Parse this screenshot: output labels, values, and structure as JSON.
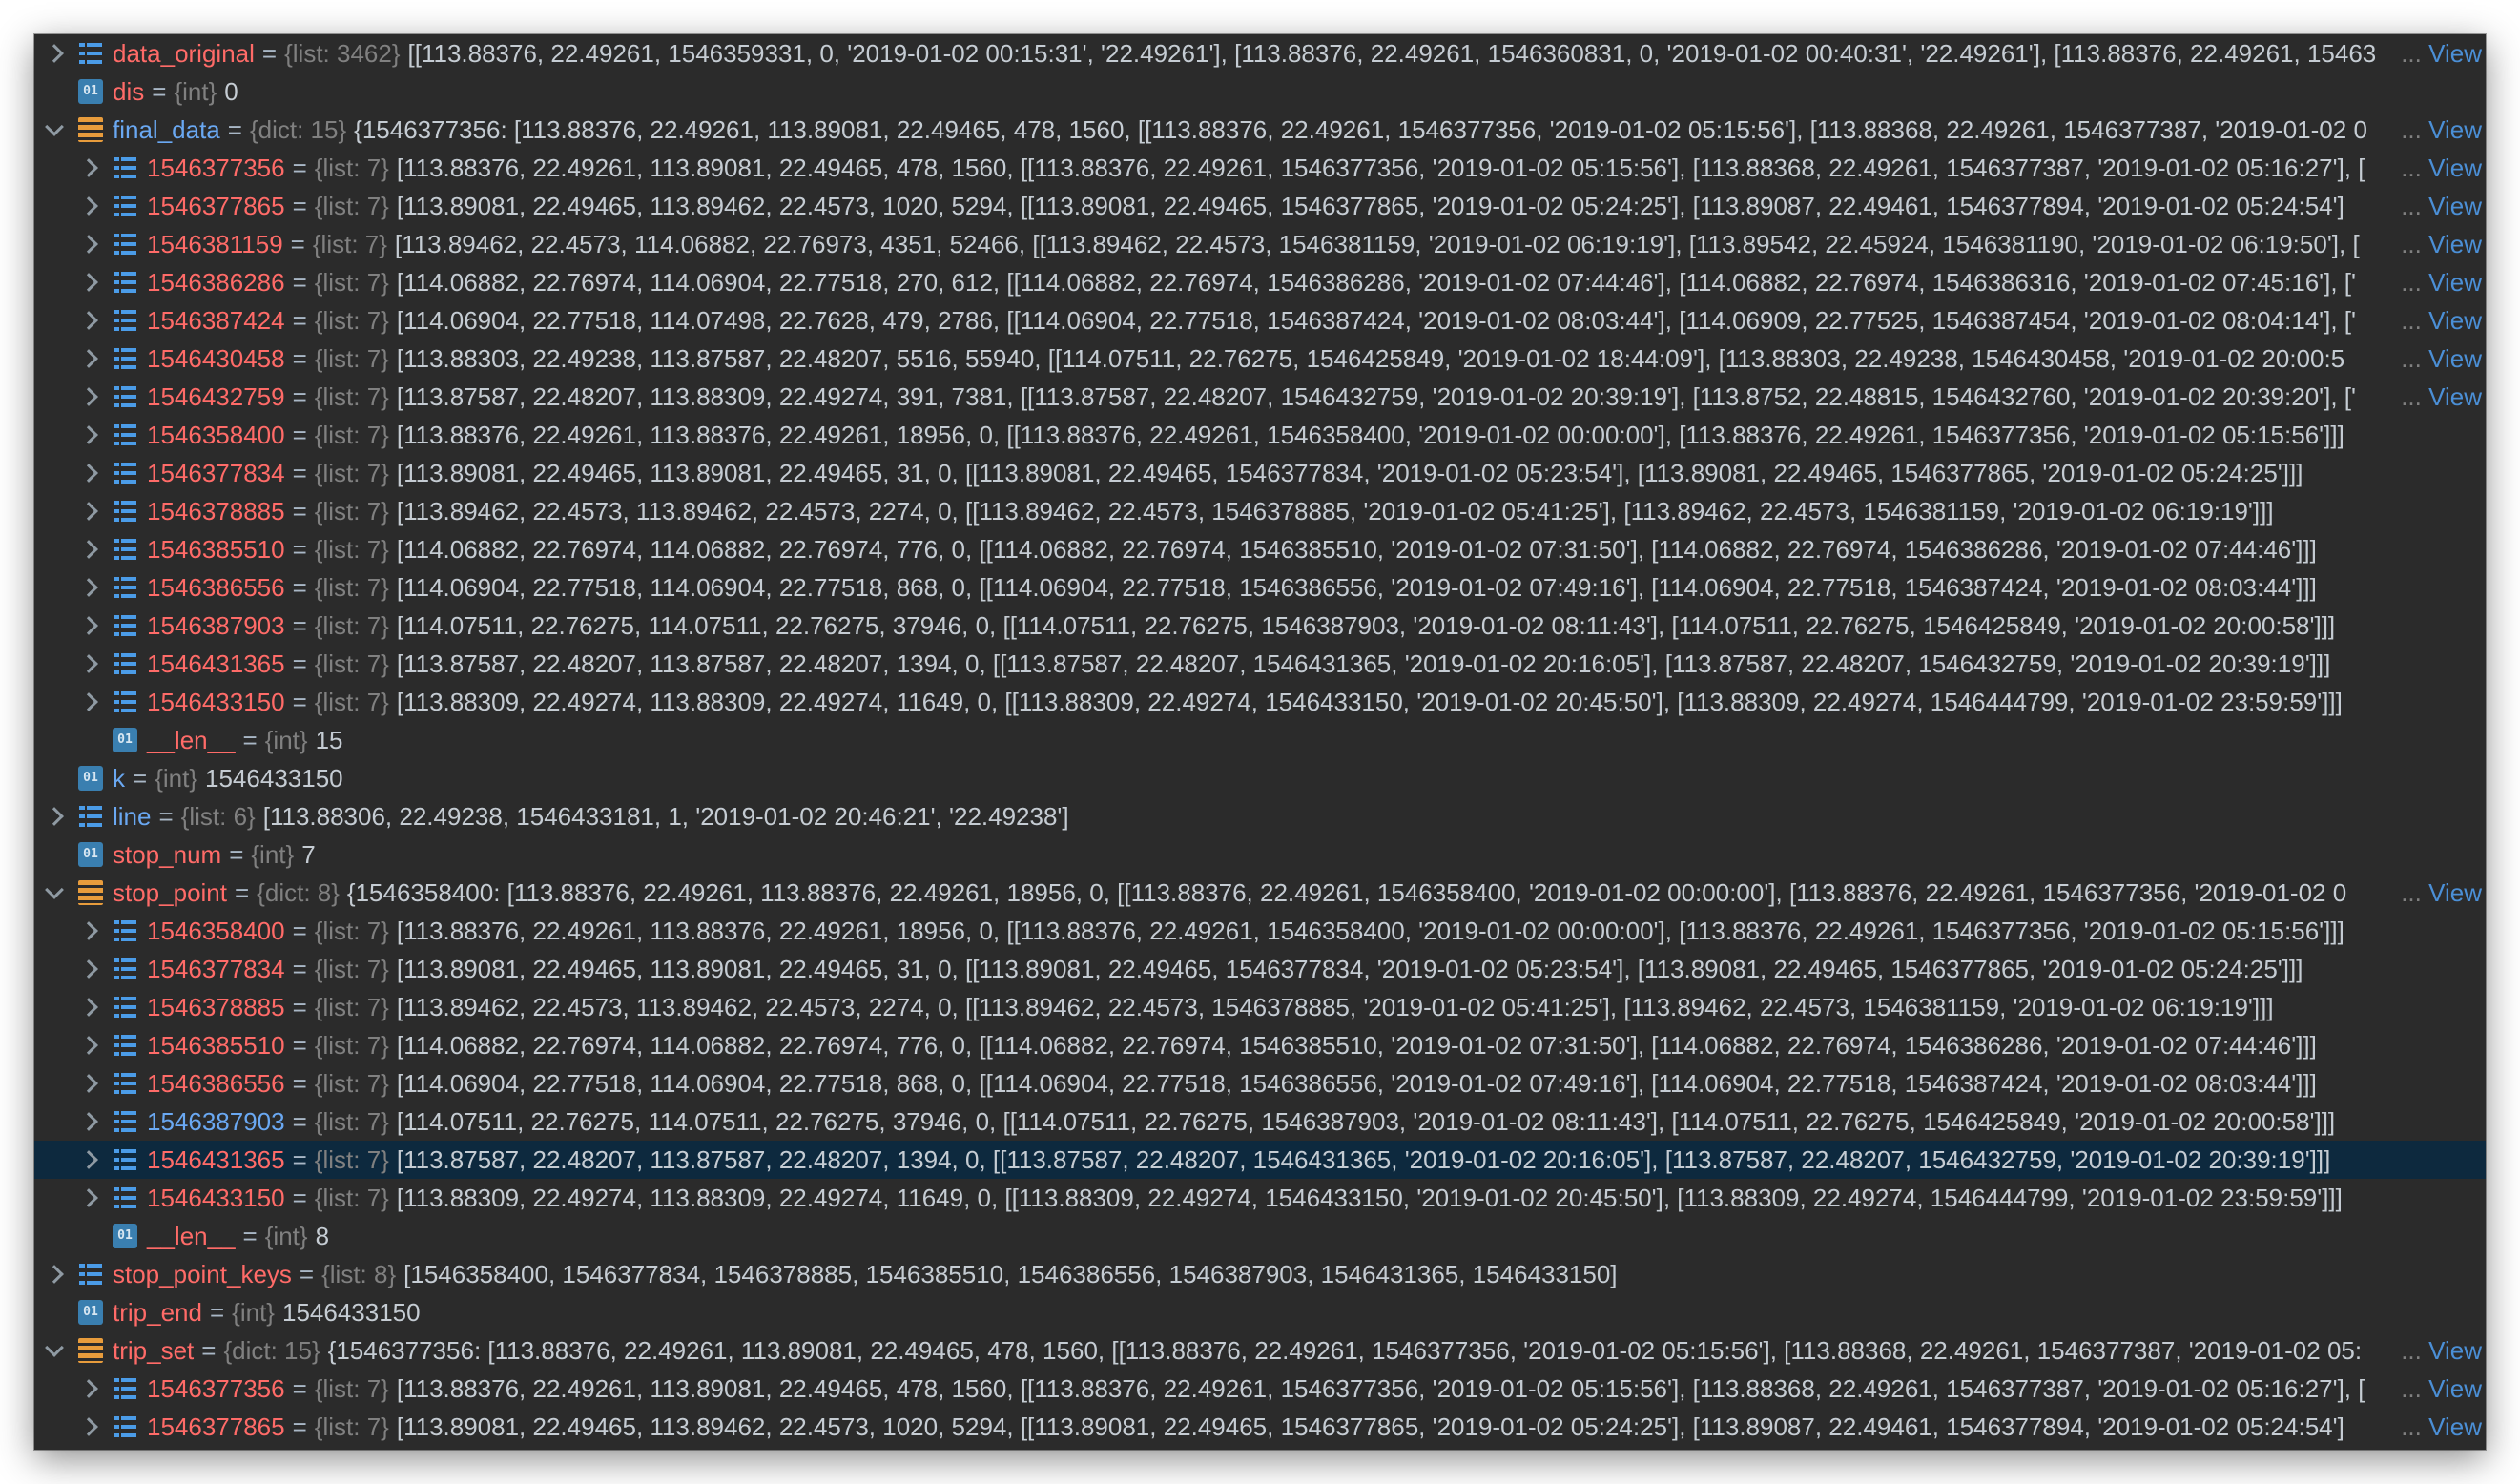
{
  "rows": [
    {
      "d": 0,
      "a": "collapsed",
      "i": "list",
      "k": "data_original",
      "kc": "red",
      "t": "{list: 3462}",
      "v": "[[113.88376, 22.49261, 1546359331, 0, '2019-01-02 00:15:31', '22.49261'], [113.88376, 22.49261, 1546360831, 0, '2019-01-02 00:40:31', '22.49261'], [113.88376, 22.49261, 15463",
      "view": "View"
    },
    {
      "d": 0,
      "a": "none",
      "i": "int",
      "k": "dis",
      "kc": "red",
      "t": "{int}",
      "v": "0"
    },
    {
      "d": 0,
      "a": "expanded",
      "i": "dict",
      "k": "final_data",
      "kc": "blue",
      "t": "{dict: 15}",
      "v": "{1546377356: [113.88376, 22.49261, 113.89081, 22.49465, 478, 1560, [[113.88376, 22.49261, 1546377356, '2019-01-02 05:15:56'], [113.88368, 22.49261, 1546377387, '2019-01-02 0",
      "view": "View"
    },
    {
      "d": 1,
      "a": "collapsed",
      "i": "list",
      "k": "1546377356",
      "kc": "red",
      "t": "{list: 7}",
      "v": "[113.88376, 22.49261, 113.89081, 22.49465, 478, 1560, [[113.88376, 22.49261, 1546377356, '2019-01-02 05:15:56'], [113.88368, 22.49261, 1546377387, '2019-01-02 05:16:27'], [",
      "view": "View"
    },
    {
      "d": 1,
      "a": "collapsed",
      "i": "list",
      "k": "1546377865",
      "kc": "red",
      "t": "{list: 7}",
      "v": "[113.89081, 22.49465, 113.89462, 22.4573, 1020, 5294, [[113.89081, 22.49465, 1546377865, '2019-01-02 05:24:25'], [113.89087, 22.49461, 1546377894, '2019-01-02 05:24:54']",
      "view": "View"
    },
    {
      "d": 1,
      "a": "collapsed",
      "i": "list",
      "k": "1546381159",
      "kc": "red",
      "t": "{list: 7}",
      "v": "[113.89462, 22.4573, 114.06882, 22.76973, 4351, 52466, [[113.89462, 22.4573, 1546381159, '2019-01-02 06:19:19'], [113.89542, 22.45924, 1546381190, '2019-01-02 06:19:50'], [",
      "view": "View"
    },
    {
      "d": 1,
      "a": "collapsed",
      "i": "list",
      "k": "1546386286",
      "kc": "red",
      "t": "{list: 7}",
      "v": "[114.06882, 22.76974, 114.06904, 22.77518, 270, 612, [[114.06882, 22.76974, 1546386286, '2019-01-02 07:44:46'], [114.06882, 22.76974, 1546386316, '2019-01-02 07:45:16'], ['",
      "view": "View"
    },
    {
      "d": 1,
      "a": "collapsed",
      "i": "list",
      "k": "1546387424",
      "kc": "red",
      "t": "{list: 7}",
      "v": "[114.06904, 22.77518, 114.07498, 22.7628, 479, 2786, [[114.06904, 22.77518, 1546387424, '2019-01-02 08:03:44'], [114.06909, 22.77525, 1546387454, '2019-01-02 08:04:14'], ['",
      "view": "View"
    },
    {
      "d": 1,
      "a": "collapsed",
      "i": "list",
      "k": "1546430458",
      "kc": "red",
      "t": "{list: 7}",
      "v": "[113.88303, 22.49238, 113.87587, 22.48207, 5516, 55940, [[114.07511, 22.76275, 1546425849, '2019-01-02 18:44:09'], [113.88303, 22.49238, 1546430458, '2019-01-02 20:00:5",
      "view": "View"
    },
    {
      "d": 1,
      "a": "collapsed",
      "i": "list",
      "k": "1546432759",
      "kc": "red",
      "t": "{list: 7}",
      "v": "[113.87587, 22.48207, 113.88309, 22.49274, 391, 7381, [[113.87587, 22.48207, 1546432759, '2019-01-02 20:39:19'], [113.8752, 22.48815, 1546432760, '2019-01-02 20:39:20'], ['",
      "view": "View"
    },
    {
      "d": 1,
      "a": "collapsed",
      "i": "list",
      "k": "1546358400",
      "kc": "red",
      "t": "{list: 7}",
      "v": "[113.88376, 22.49261, 113.88376, 22.49261, 18956, 0, [[113.88376, 22.49261, 1546358400, '2019-01-02 00:00:00'], [113.88376, 22.49261, 1546377356, '2019-01-02 05:15:56']]]"
    },
    {
      "d": 1,
      "a": "collapsed",
      "i": "list",
      "k": "1546377834",
      "kc": "red",
      "t": "{list: 7}",
      "v": "[113.89081, 22.49465, 113.89081, 22.49465, 31, 0, [[113.89081, 22.49465, 1546377834, '2019-01-02 05:23:54'], [113.89081, 22.49465, 1546377865, '2019-01-02 05:24:25']]]"
    },
    {
      "d": 1,
      "a": "collapsed",
      "i": "list",
      "k": "1546378885",
      "kc": "red",
      "t": "{list: 7}",
      "v": "[113.89462, 22.4573, 113.89462, 22.4573, 2274, 0, [[113.89462, 22.4573, 1546378885, '2019-01-02 05:41:25'], [113.89462, 22.4573, 1546381159, '2019-01-02 06:19:19']]]"
    },
    {
      "d": 1,
      "a": "collapsed",
      "i": "list",
      "k": "1546385510",
      "kc": "red",
      "t": "{list: 7}",
      "v": "[114.06882, 22.76974, 114.06882, 22.76974, 776, 0, [[114.06882, 22.76974, 1546385510, '2019-01-02 07:31:50'], [114.06882, 22.76974, 1546386286, '2019-01-02 07:44:46']]]"
    },
    {
      "d": 1,
      "a": "collapsed",
      "i": "list",
      "k": "1546386556",
      "kc": "red",
      "t": "{list: 7}",
      "v": "[114.06904, 22.77518, 114.06904, 22.77518, 868, 0, [[114.06904, 22.77518, 1546386556, '2019-01-02 07:49:16'], [114.06904, 22.77518, 1546387424, '2019-01-02 08:03:44']]]"
    },
    {
      "d": 1,
      "a": "collapsed",
      "i": "list",
      "k": "1546387903",
      "kc": "red",
      "t": "{list: 7}",
      "v": "[114.07511, 22.76275, 114.07511, 22.76275, 37946, 0, [[114.07511, 22.76275, 1546387903, '2019-01-02 08:11:43'], [114.07511, 22.76275, 1546425849, '2019-01-02 20:00:58']]]"
    },
    {
      "d": 1,
      "a": "collapsed",
      "i": "list",
      "k": "1546431365",
      "kc": "red",
      "t": "{list: 7}",
      "v": "[113.87587, 22.48207, 113.87587, 22.48207, 1394, 0, [[113.87587, 22.48207, 1546431365, '2019-01-02 20:16:05'], [113.87587, 22.48207, 1546432759, '2019-01-02 20:39:19']]]"
    },
    {
      "d": 1,
      "a": "collapsed",
      "i": "list",
      "k": "1546433150",
      "kc": "red",
      "t": "{list: 7}",
      "v": "[113.88309, 22.49274, 113.88309, 22.49274, 11649, 0, [[113.88309, 22.49274, 1546433150, '2019-01-02 20:45:50'], [113.88309, 22.49274, 1546444799, '2019-01-02 23:59:59']]]"
    },
    {
      "d": 1,
      "a": "none",
      "i": "int",
      "k": "__len__",
      "kc": "red",
      "t": "{int}",
      "v": "15"
    },
    {
      "d": 0,
      "a": "none",
      "i": "int",
      "k": "k",
      "kc": "blue",
      "t": "{int}",
      "v": "1546433150"
    },
    {
      "d": 0,
      "a": "collapsed",
      "i": "list",
      "k": "line",
      "kc": "blue",
      "t": "{list: 6}",
      "v": "[113.88306, 22.49238, 1546433181, 1, '2019-01-02 20:46:21', '22.49238']"
    },
    {
      "d": 0,
      "a": "none",
      "i": "int",
      "k": "stop_num",
      "kc": "red",
      "t": "{int}",
      "v": "7"
    },
    {
      "d": 0,
      "a": "expanded",
      "i": "dict",
      "k": "stop_point",
      "kc": "red",
      "t": "{dict: 8}",
      "v": "{1546358400: [113.88376, 22.49261, 113.88376, 22.49261, 18956, 0, [[113.88376, 22.49261, 1546358400, '2019-01-02 00:00:00'], [113.88376, 22.49261, 1546377356, '2019-01-02 0",
      "view": "View"
    },
    {
      "d": 1,
      "a": "collapsed",
      "i": "list",
      "k": "1546358400",
      "kc": "red",
      "t": "{list: 7}",
      "v": "[113.88376, 22.49261, 113.88376, 22.49261, 18956, 0, [[113.88376, 22.49261, 1546358400, '2019-01-02 00:00:00'], [113.88376, 22.49261, 1546377356, '2019-01-02 05:15:56']]]"
    },
    {
      "d": 1,
      "a": "collapsed",
      "i": "list",
      "k": "1546377834",
      "kc": "red",
      "t": "{list: 7}",
      "v": "[113.89081, 22.49465, 113.89081, 22.49465, 31, 0, [[113.89081, 22.49465, 1546377834, '2019-01-02 05:23:54'], [113.89081, 22.49465, 1546377865, '2019-01-02 05:24:25']]]"
    },
    {
      "d": 1,
      "a": "collapsed",
      "i": "list",
      "k": "1546378885",
      "kc": "red",
      "t": "{list: 7}",
      "v": "[113.89462, 22.4573, 113.89462, 22.4573, 2274, 0, [[113.89462, 22.4573, 1546378885, '2019-01-02 05:41:25'], [113.89462, 22.4573, 1546381159, '2019-01-02 06:19:19']]]"
    },
    {
      "d": 1,
      "a": "collapsed",
      "i": "list",
      "k": "1546385510",
      "kc": "red",
      "t": "{list: 7}",
      "v": "[114.06882, 22.76974, 114.06882, 22.76974, 776, 0, [[114.06882, 22.76974, 1546385510, '2019-01-02 07:31:50'], [114.06882, 22.76974, 1546386286, '2019-01-02 07:44:46']]]"
    },
    {
      "d": 1,
      "a": "collapsed",
      "i": "list",
      "k": "1546386556",
      "kc": "red",
      "t": "{list: 7}",
      "v": "[114.06904, 22.77518, 114.06904, 22.77518, 868, 0, [[114.06904, 22.77518, 1546386556, '2019-01-02 07:49:16'], [114.06904, 22.77518, 1546387424, '2019-01-02 08:03:44']]]"
    },
    {
      "d": 1,
      "a": "collapsed",
      "i": "list",
      "k": "1546387903",
      "kc": "blue",
      "t": "{list: 7}",
      "v": "[114.07511, 22.76275, 114.07511, 22.76275, 37946, 0, [[114.07511, 22.76275, 1546387903, '2019-01-02 08:11:43'], [114.07511, 22.76275, 1546425849, '2019-01-02 20:00:58']]]"
    },
    {
      "d": 1,
      "a": "collapsed",
      "i": "list",
      "k": "1546431365",
      "kc": "red",
      "t": "{list: 7}",
      "v": "[113.87587, 22.48207, 113.87587, 22.48207, 1394, 0, [[113.87587, 22.48207, 1546431365, '2019-01-02 20:16:05'], [113.87587, 22.48207, 1546432759, '2019-01-02 20:39:19']]]",
      "selected": true
    },
    {
      "d": 1,
      "a": "collapsed",
      "i": "list",
      "k": "1546433150",
      "kc": "red",
      "t": "{list: 7}",
      "v": "[113.88309, 22.49274, 113.88309, 22.49274, 11649, 0, [[113.88309, 22.49274, 1546433150, '2019-01-02 20:45:50'], [113.88309, 22.49274, 1546444799, '2019-01-02 23:59:59']]]"
    },
    {
      "d": 1,
      "a": "none",
      "i": "int",
      "k": "__len__",
      "kc": "red",
      "t": "{int}",
      "v": "8"
    },
    {
      "d": 0,
      "a": "collapsed",
      "i": "list",
      "k": "stop_point_keys",
      "kc": "red",
      "t": "{list: 8}",
      "v": "[1546358400, 1546377834, 1546378885, 1546385510, 1546386556, 1546387903, 1546431365, 1546433150]"
    },
    {
      "d": 0,
      "a": "none",
      "i": "int",
      "k": "trip_end",
      "kc": "red",
      "t": "{int}",
      "v": "1546433150"
    },
    {
      "d": 0,
      "a": "expanded",
      "i": "dict",
      "k": "trip_set",
      "kc": "red",
      "t": "{dict: 15}",
      "v": "{1546377356: [113.88376, 22.49261, 113.89081, 22.49465, 478, 1560, [[113.88376, 22.49261, 1546377356, '2019-01-02 05:15:56'], [113.88368, 22.49261, 1546377387, '2019-01-02 05:",
      "view": "View"
    },
    {
      "d": 1,
      "a": "collapsed",
      "i": "list",
      "k": "1546377356",
      "kc": "red",
      "t": "{list: 7}",
      "v": "[113.88376, 22.49261, 113.89081, 22.49465, 478, 1560, [[113.88376, 22.49261, 1546377356, '2019-01-02 05:15:56'], [113.88368, 22.49261, 1546377387, '2019-01-02 05:16:27'], [",
      "view": "View"
    },
    {
      "d": 1,
      "a": "collapsed",
      "i": "list",
      "k": "1546377865",
      "kc": "red",
      "t": "{list: 7}",
      "v": "[113.89081, 22.49465, 113.89462, 22.4573, 1020, 5294, [[113.89081, 22.49465, 1546377865, '2019-01-02 05:24:25'], [113.89087, 22.49461, 1546377894, '2019-01-02 05:24:54']",
      "view": "View"
    }
  ],
  "ellipsis": "...",
  "int_icon_text": "01",
  "colors": {
    "background": "#2b2b2b",
    "selected_row": "#0d293e",
    "key_red": "#ff6b68",
    "key_blue": "#6aa8f2",
    "link": "#4b8fd6"
  }
}
